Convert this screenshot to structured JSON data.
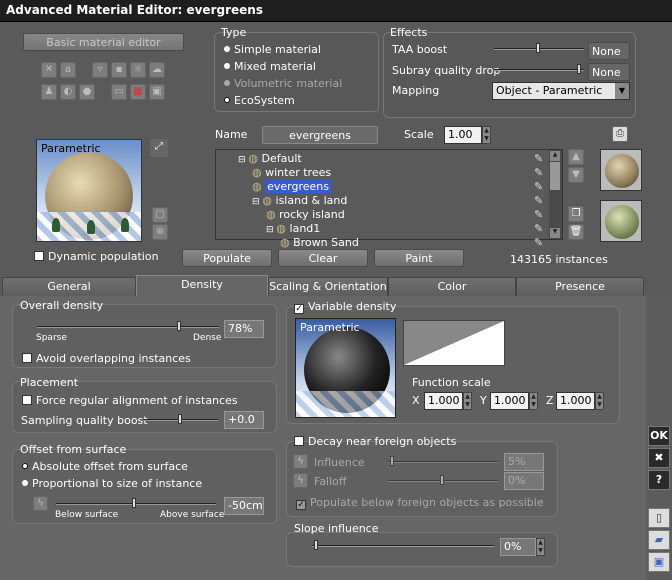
{
  "window": {
    "title": "Advanced Material Editor: evergreens"
  },
  "left": {
    "basic_button": "Basic material editor",
    "preview_label": "Parametric",
    "dynamic_population": "Dynamic population",
    "icons": [
      "wand-icon",
      "text-icon",
      "sky-icon",
      "target-icon",
      "sun-icon",
      "cloud-icon",
      "person-icon",
      "half-icon",
      "dot-icon",
      "film-icon",
      "grid-icon",
      "image-icon"
    ]
  },
  "type": {
    "title": "Type",
    "options": [
      {
        "label": "Simple material",
        "selected": false,
        "enabled": true
      },
      {
        "label": "Mixed material",
        "selected": false,
        "enabled": true
      },
      {
        "label": "Volumetric material",
        "selected": false,
        "enabled": false
      },
      {
        "label": "EcoSystem",
        "selected": true,
        "enabled": true
      }
    ]
  },
  "effects": {
    "title": "Effects",
    "taa_label": "TAA boost",
    "taa_value": "None",
    "subray_label": "Subray quality drop",
    "subray_value": "None",
    "mapping_label": "Mapping",
    "mapping_value": "Object - Parametric"
  },
  "name_row": {
    "name_label": "Name",
    "name_value": "evergreens",
    "scale_label": "Scale",
    "scale_value": "1.00"
  },
  "tree": {
    "rows": [
      {
        "label": "Default",
        "indent": 0,
        "selected": false
      },
      {
        "label": "winter trees",
        "indent": 1,
        "selected": false
      },
      {
        "label": "evergreens",
        "indent": 1,
        "selected": true
      },
      {
        "label": "island & land",
        "indent": 1,
        "selected": false
      },
      {
        "label": "rocky island",
        "indent": 2,
        "selected": false
      },
      {
        "label": "land1",
        "indent": 2,
        "selected": false
      },
      {
        "label": "Brown Sand",
        "indent": 3,
        "selected": false
      }
    ]
  },
  "actions": {
    "populate": "Populate",
    "clear": "Clear",
    "paint": "Paint",
    "instances": "143165 instances"
  },
  "tabs": [
    {
      "label": "General",
      "active": false
    },
    {
      "label": "Density",
      "active": true
    },
    {
      "label": "Scaling & Orientation",
      "active": false
    },
    {
      "label": "Color",
      "active": false
    },
    {
      "label": "Presence",
      "active": false
    }
  ],
  "overall_density": {
    "title": "Overall density",
    "sparse": "Sparse",
    "dense": "Dense",
    "value": "78%",
    "level": 0.78,
    "avoid": "Avoid overlapping instances"
  },
  "placement": {
    "title": "Placement",
    "force": "Force regular alignment of instances",
    "sampling_label": "Sampling quality boost",
    "sampling_value": "+0.0"
  },
  "offset": {
    "title": "Offset from surface",
    "absolute": "Absolute offset from surface",
    "proportional": "Proportional to size of instance",
    "below": "Below surface",
    "above": "Above surface",
    "value": "-50cm"
  },
  "variable_density": {
    "label": "Variable density",
    "checked": true,
    "preview_label": "Parametric",
    "function_scale": "Function scale",
    "x_label": "X",
    "x_value": "1.000",
    "y_label": "Y",
    "y_value": "1.000",
    "z_label": "Z",
    "z_value": "1.000"
  },
  "decay": {
    "label": "Decay near foreign objects",
    "influence_label": "Influence",
    "influence_value": "5%",
    "falloff_label": "Falloff",
    "falloff_value": "0%",
    "populate_below": "Populate below foreign objects as possible"
  },
  "slope": {
    "title": "Slope influence",
    "value": "0%"
  },
  "side": {
    "ok": "OK",
    "close": "✖",
    "help": "?"
  },
  "colors": {
    "selection": "#3a5ad0",
    "title_bar": "#1e1e1e"
  }
}
